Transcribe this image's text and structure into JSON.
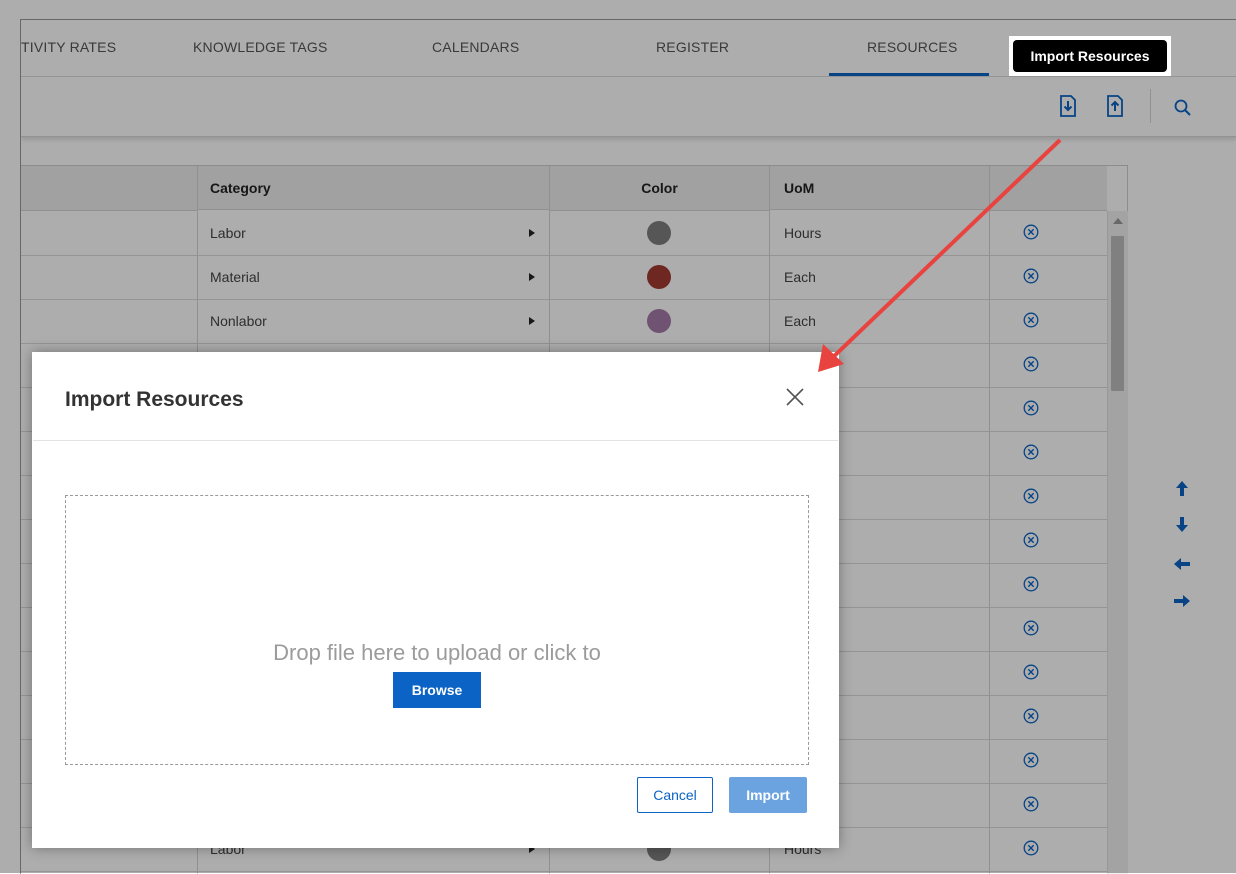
{
  "tabs": [
    {
      "label": "TIVITY RATES"
    },
    {
      "label": "KNOWLEDGE TAGS"
    },
    {
      "label": "CALENDARS"
    },
    {
      "label": "REGISTER"
    },
    {
      "label": "RESOURCES",
      "active": true
    }
  ],
  "toolbar": {
    "icons": [
      "import-icon",
      "export-icon",
      "search-icon"
    ],
    "tooltip": "Import Resources"
  },
  "grid": {
    "columns": [
      "Category",
      "Color",
      "UoM"
    ],
    "rows": [
      {
        "category": "Labor",
        "color": "#7f7f7f",
        "uom": "Hours"
      },
      {
        "category": "Material",
        "color": "#a23a32",
        "uom": "Each"
      },
      {
        "category": "Nonlabor",
        "color": "#a57ba8",
        "uom": "Each"
      },
      {
        "category": "",
        "color": "",
        "uom": ""
      },
      {
        "category": "",
        "color": "",
        "uom": ""
      },
      {
        "category": "",
        "color": "",
        "uom": ""
      },
      {
        "category": "",
        "color": "",
        "uom": ""
      },
      {
        "category": "",
        "color": "",
        "uom": ""
      },
      {
        "category": "",
        "color": "",
        "uom": ""
      },
      {
        "category": "",
        "color": "",
        "uom": ""
      },
      {
        "category": "",
        "color": "",
        "uom": ""
      },
      {
        "category": "",
        "color": "",
        "uom": ""
      },
      {
        "category": "",
        "color": "",
        "uom": ""
      },
      {
        "category": "",
        "color": "",
        "uom": ""
      },
      {
        "category": "Labor",
        "color": "#7f7f7f",
        "uom": "Hours"
      }
    ]
  },
  "side_arrows": [
    "arrow-up-icon",
    "arrow-down-icon",
    "arrow-left-icon",
    "arrow-right-icon"
  ],
  "modal": {
    "title": "Import Resources",
    "drop_text": "Drop file here to upload or click to",
    "browse_label": "Browse",
    "cancel_label": "Cancel",
    "import_label": "Import"
  },
  "colors": {
    "accent": "#0b63c5",
    "import_disabled": "#6aa3e0",
    "callout": "#e8433f"
  }
}
